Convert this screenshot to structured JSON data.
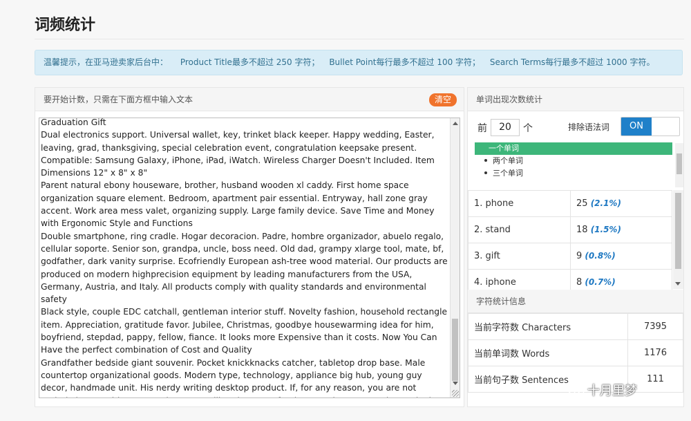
{
  "page": {
    "title": "词频统计"
  },
  "notice": {
    "lead": "温馨提示，在亚马逊卖家后台中：",
    "items": [
      "Product Title最多不超过 250 字符；",
      "Bullet Point每行最多不超过 100 字符；",
      "Search Terms每行最多不超过 1000 字符。"
    ]
  },
  "input_panel": {
    "header": "要开始计数，只需在下面方框中输入文本",
    "clear_label": "清空",
    "paragraphs": [
      "Graduation Gift",
      "Dual electronics support. Universal wallet, key, trinket black keeper. Happy wedding, Easter, leaving, grad, thanksgiving, special celebration event, congratulation keepsake present. Compatible: Samsung Galaxy, iPhone, iPad, iWatch. Wireless Charger Doesn't Included. Item Dimensions 12\" x 8\" x 8\"",
      "Parent natural ebony houseware, brother, husband wooden xl caddy. First home space organization square element. Bedroom, apartment pair essential. Entryway, hall zone gray accent. Work area mess valet, organizing supply. Large family device. Save Time and Money with Ergonomic Style and Functions",
      "Double smartphone, ring cradle. Hogar decoracion. Padre, hombre organizador, abuelo regalo, cellular soporte. Senior son, grandpa, uncle, boss need. Old dad, grampy xlarge tool, mate, bf, godfather, dark vanity surprise. Ecofriendly European ash-tree wood material. Our products are produced on modern highprecision equipment by leading manufacturers from the USA, Germany, Austria, and Italy. All products comply with quality standards and environmental safety",
      "Black style, couple EDC catchall, gentleman interior stuff. Novelty fashion, household rectangle item. Appreciation, gratitude favor. Jubilee, Christmas, goodbye housewarming idea for him, boyfriend, stepdad, pappy, fellow, fiance. It looks more Expensive than it costs. Now You Can Have the perfect combination of Cost and Quality",
      "Grandfather bedside giant souvenir. Pocket knickknacks catcher, tabletop drop base. Male countertop organizational goods. Modern type, technology, appliance big hub, young guy decor, handmade unit. His nerdy writing desktop product. If, for any reason, you are not entirely happy with your purchase, we will replace or refund your order, no questions asked. Contact us right away if you experience any problems"
    ]
  },
  "freq_panel": {
    "header": "单词出现次数统计",
    "top_prefix": "前",
    "top_n": "20",
    "top_suffix": "个",
    "exclude_label": "排除语法词",
    "toggle_label": "ON",
    "gram_options": [
      "一个单词",
      "两个单词",
      "三个单词"
    ],
    "selected_gram": "一个单词",
    "rows": [
      {
        "word": "1. phone",
        "count": "25",
        "pct": "(2.1%)"
      },
      {
        "word": "2. stand",
        "count": "18",
        "pct": "(1.5%)"
      },
      {
        "word": "3. gift",
        "count": "9",
        "pct": "(0.8%)"
      },
      {
        "word": "4. iphone",
        "count": "8",
        "pct": "(0.7%)"
      }
    ]
  },
  "char_panel": {
    "header": "字符统计信息",
    "rows": [
      {
        "label": "当前字符数 Characters",
        "value": "7395"
      },
      {
        "label": "当前单词数 Words",
        "value": "1176"
      },
      {
        "label": "当前句子数 Sentences",
        "value": "111"
      }
    ]
  },
  "watermark": {
    "text": "十月里梦"
  },
  "colors": {
    "accent": "#1f80c9",
    "clear_button": "#f0732c",
    "selected_option": "#3db67a",
    "percent": "#1e78c2"
  }
}
